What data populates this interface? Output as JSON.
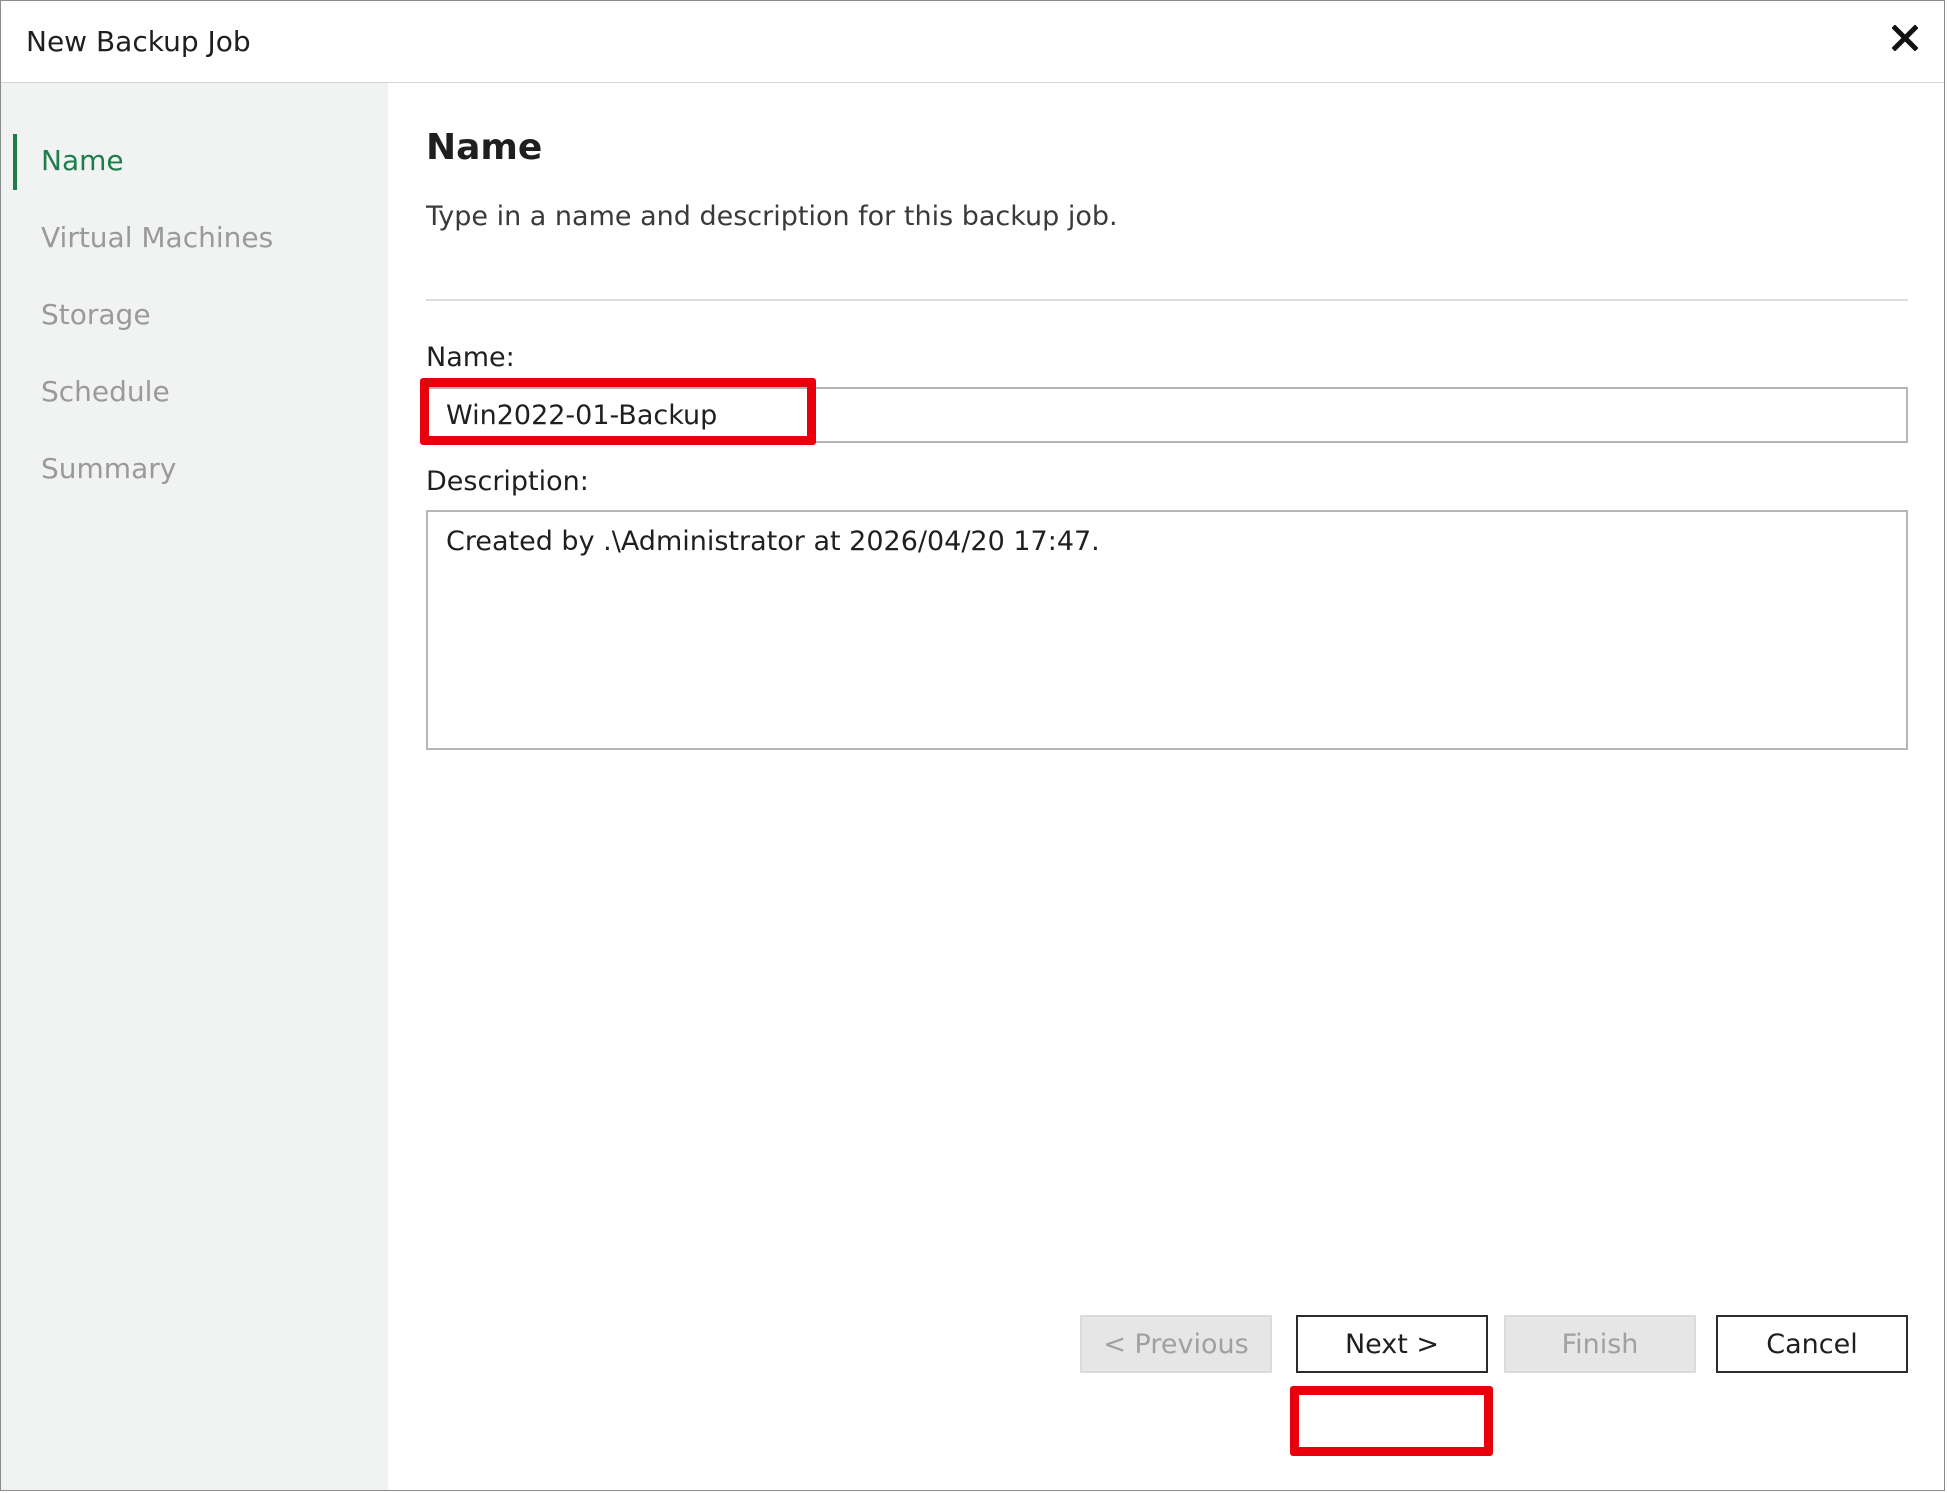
{
  "window": {
    "title": "New Backup Job",
    "close_icon": "close-icon"
  },
  "sidebar": {
    "items": [
      {
        "label": "Name",
        "active": true
      },
      {
        "label": "Virtual Machines",
        "active": false
      },
      {
        "label": "Storage",
        "active": false
      },
      {
        "label": "Schedule",
        "active": false
      },
      {
        "label": "Summary",
        "active": false
      }
    ]
  },
  "main": {
    "title": "Name",
    "description": "Type in a name and description for this backup job.",
    "name_label": "Name:",
    "name_value": "Win2022-01-Backup",
    "description_label": "Description:",
    "description_value": "Created by .\\Administrator at 2026/04/20 17:47."
  },
  "footer": {
    "previous_label": "< Previous",
    "next_label": "Next >",
    "finish_label": "Finish",
    "cancel_label": "Cancel"
  },
  "colors": {
    "accent_green": "#1e7d4a",
    "highlight_red": "#e8000d",
    "sidebar_bg": "#f1f2f2"
  }
}
